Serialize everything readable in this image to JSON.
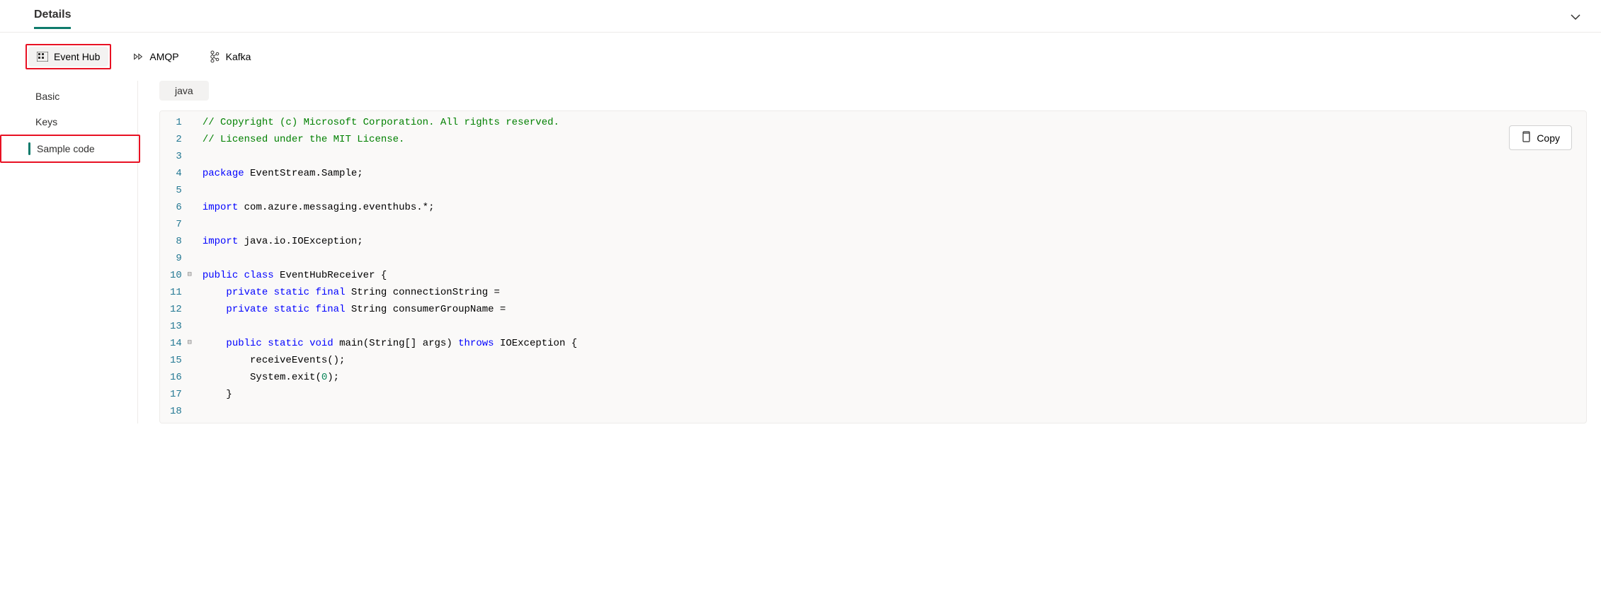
{
  "header": {
    "title": "Details"
  },
  "protocols": [
    {
      "label": "Event Hub",
      "active": true,
      "icon": "eventhub"
    },
    {
      "label": "AMQP",
      "active": false,
      "icon": "amqp"
    },
    {
      "label": "Kafka",
      "active": false,
      "icon": "kafka"
    }
  ],
  "sidebar": {
    "items": [
      {
        "label": "Basic",
        "active": false
      },
      {
        "label": "Keys",
        "active": false
      },
      {
        "label": "Sample code",
        "active": true
      }
    ]
  },
  "language_tab": "java",
  "copy_label": "Copy",
  "code": {
    "lines": [
      {
        "n": 1,
        "tokens": [
          {
            "c": "comment",
            "t": "// Copyright (c) Microsoft Corporation. All rights reserved."
          }
        ]
      },
      {
        "n": 2,
        "tokens": [
          {
            "c": "comment",
            "t": "// Licensed under the MIT License."
          }
        ]
      },
      {
        "n": 3,
        "tokens": []
      },
      {
        "n": 4,
        "tokens": [
          {
            "c": "keyword",
            "t": "package"
          },
          {
            "c": "text",
            "t": " EventStream.Sample;"
          }
        ]
      },
      {
        "n": 5,
        "tokens": []
      },
      {
        "n": 6,
        "tokens": [
          {
            "c": "keyword",
            "t": "import"
          },
          {
            "c": "text",
            "t": " com.azure.messaging.eventhubs.*;"
          }
        ]
      },
      {
        "n": 7,
        "tokens": []
      },
      {
        "n": 8,
        "tokens": [
          {
            "c": "keyword",
            "t": "import"
          },
          {
            "c": "text",
            "t": " java.io.IOException;"
          }
        ]
      },
      {
        "n": 9,
        "tokens": []
      },
      {
        "n": 10,
        "fold": true,
        "tokens": [
          {
            "c": "keyword",
            "t": "public"
          },
          {
            "c": "text",
            "t": " "
          },
          {
            "c": "keyword",
            "t": "class"
          },
          {
            "c": "text",
            "t": " EventHubReceiver {"
          }
        ]
      },
      {
        "n": 11,
        "tokens": [
          {
            "c": "text",
            "t": "    "
          },
          {
            "c": "keyword",
            "t": "private"
          },
          {
            "c": "text",
            "t": " "
          },
          {
            "c": "keyword",
            "t": "static"
          },
          {
            "c": "text",
            "t": " "
          },
          {
            "c": "keyword",
            "t": "final"
          },
          {
            "c": "text",
            "t": " String connectionString ="
          }
        ]
      },
      {
        "n": 12,
        "tokens": [
          {
            "c": "text",
            "t": "    "
          },
          {
            "c": "keyword",
            "t": "private"
          },
          {
            "c": "text",
            "t": " "
          },
          {
            "c": "keyword",
            "t": "static"
          },
          {
            "c": "text",
            "t": " "
          },
          {
            "c": "keyword",
            "t": "final"
          },
          {
            "c": "text",
            "t": " String consumerGroupName ="
          }
        ]
      },
      {
        "n": 13,
        "tokens": []
      },
      {
        "n": 14,
        "fold": true,
        "tokens": [
          {
            "c": "text",
            "t": "    "
          },
          {
            "c": "keyword",
            "t": "public"
          },
          {
            "c": "text",
            "t": " "
          },
          {
            "c": "keyword",
            "t": "static"
          },
          {
            "c": "text",
            "t": " "
          },
          {
            "c": "keyword",
            "t": "void"
          },
          {
            "c": "text",
            "t": " main(String[] args) "
          },
          {
            "c": "keyword",
            "t": "throws"
          },
          {
            "c": "text",
            "t": " IOException {"
          }
        ]
      },
      {
        "n": 15,
        "tokens": [
          {
            "c": "text",
            "t": "        receiveEvents();"
          }
        ]
      },
      {
        "n": 16,
        "tokens": [
          {
            "c": "text",
            "t": "        System.exit("
          },
          {
            "c": "num",
            "t": "0"
          },
          {
            "c": "text",
            "t": ");"
          }
        ]
      },
      {
        "n": 17,
        "tokens": [
          {
            "c": "text",
            "t": "    }"
          }
        ]
      },
      {
        "n": 18,
        "tokens": []
      }
    ]
  }
}
